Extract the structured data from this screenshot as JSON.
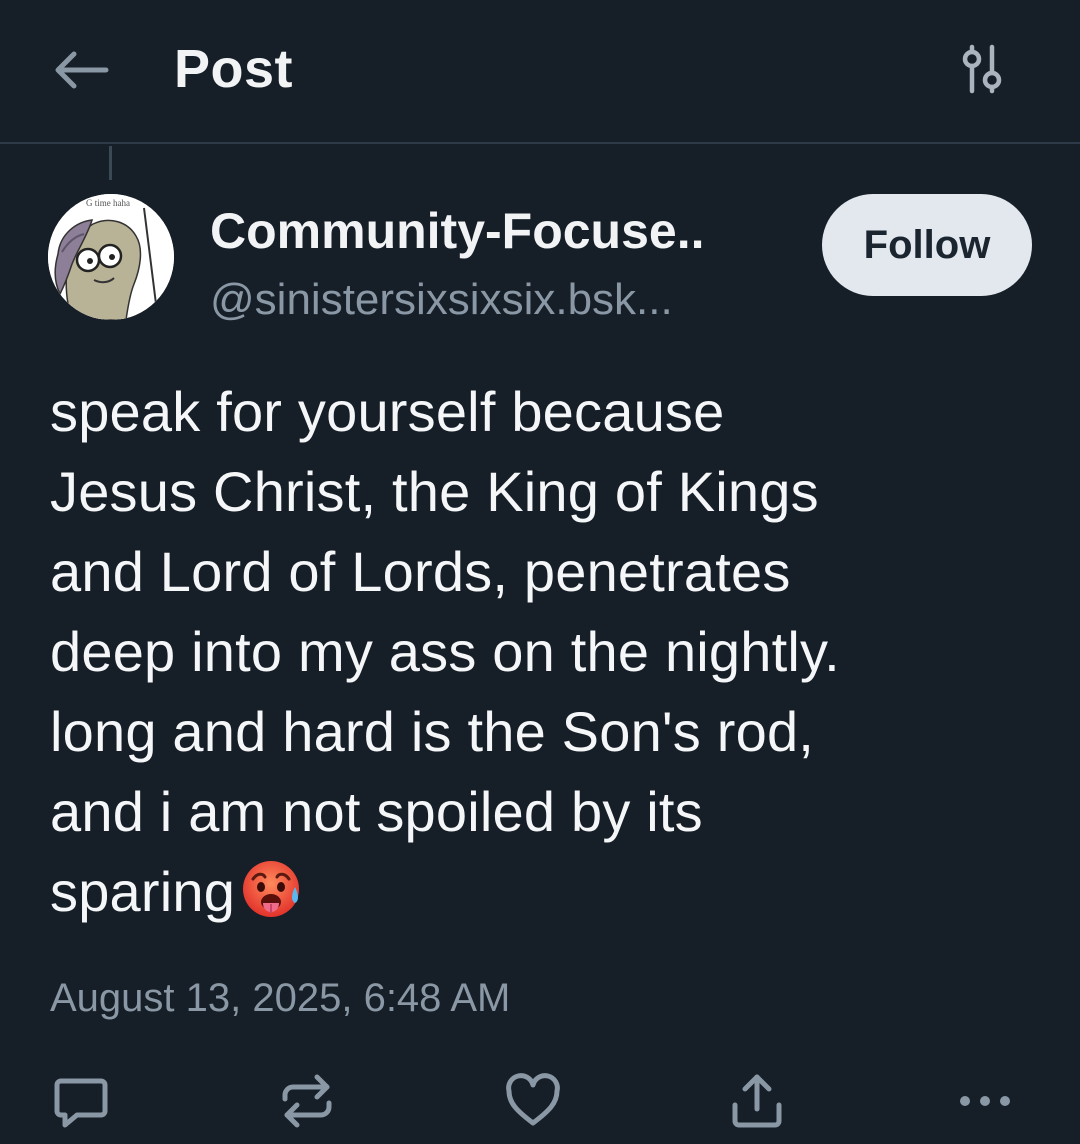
{
  "header": {
    "title": "Post",
    "back_icon": "arrow-left-icon",
    "filter_icon": "sliders-icon"
  },
  "author": {
    "display_name": "Community-Focuse..",
    "handle": "@sinistersixsixsix.bsk...",
    "follow_label": "Follow",
    "avatar_caption": "G time haha"
  },
  "post": {
    "lines": [
      "speak for yourself because",
      "Jesus Christ, the King of Kings",
      "and Lord of Lords, penetrates",
      "deep into my ass on the nightly.",
      "long and hard is the Son's rod,",
      "and i am not spoiled by its",
      "sparing"
    ],
    "emoji": "hot-face-sweat-emoji",
    "timestamp": "August 13, 2025, 6:48 AM"
  },
  "actions": [
    {
      "icon": "reply-icon"
    },
    {
      "icon": "repost-icon"
    },
    {
      "icon": "like-icon"
    },
    {
      "icon": "share-icon"
    },
    {
      "icon": "more-icon"
    }
  ],
  "colors": {
    "background": "#161e27",
    "text": "#f1f3f5",
    "muted": "#8a97a5",
    "follow_bg": "#e3e8ef",
    "divider": "#2e3a47"
  }
}
